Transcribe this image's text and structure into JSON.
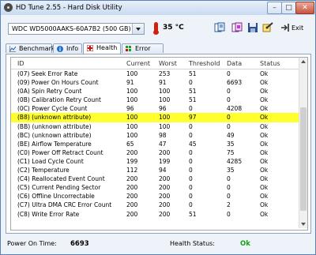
{
  "window": {
    "title": "HD Tune 2.55 - Hard Disk Utility",
    "min_label": "–",
    "max_label": "□",
    "close_label": "✕"
  },
  "toolbar": {
    "drive": "WDC WD5000AAKS-60A7B2 (500 GB)",
    "temperature": "35 °C",
    "exit_label": "Exit",
    "icons": [
      "copy-text-icon",
      "copy-image-icon",
      "save-icon",
      "options-icon",
      "exit-icon"
    ]
  },
  "tabs": [
    {
      "label": "Benchmark",
      "icon": "benchmark-icon"
    },
    {
      "label": "Info",
      "icon": "info-icon"
    },
    {
      "label": "Health",
      "icon": "health-cross-icon"
    },
    {
      "label": "Error Scan",
      "icon": "error-scan-icon"
    }
  ],
  "columns": [
    "ID",
    "Current",
    "Worst",
    "Threshold",
    "Data",
    "Status"
  ],
  "rows": [
    [
      "(07) Seek Error Rate",
      "100",
      "253",
      "51",
      "0",
      "Ok"
    ],
    [
      "(09) Power On Hours Count",
      "91",
      "91",
      "0",
      "6693",
      "Ok"
    ],
    [
      "(0A) Spin Retry Count",
      "100",
      "100",
      "51",
      "0",
      "Ok"
    ],
    [
      "(0B) Calibration Retry Count",
      "100",
      "100",
      "51",
      "0",
      "Ok"
    ],
    [
      "(0C) Power Cycle Count",
      "96",
      "96",
      "0",
      "4208",
      "Ok"
    ],
    [
      "(B8) (unknown attribute)",
      "100",
      "100",
      "97",
      "0",
      "Ok"
    ],
    [
      "(BB) (unknown attribute)",
      "100",
      "100",
      "0",
      "0",
      "Ok"
    ],
    [
      "(BC) (unknown attribute)",
      "100",
      "98",
      "0",
      "49",
      "Ok"
    ],
    [
      "(BE) Airflow Temperature",
      "65",
      "47",
      "45",
      "35",
      "Ok"
    ],
    [
      "(C0) Power Off Retract Count",
      "200",
      "200",
      "0",
      "75",
      "Ok"
    ],
    [
      "(C1) Load Cycle Count",
      "199",
      "199",
      "0",
      "4285",
      "Ok"
    ],
    [
      "(C2) Temperature",
      "112",
      "94",
      "0",
      "35",
      "Ok"
    ],
    [
      "(C4) Reallocated Event Count",
      "200",
      "200",
      "0",
      "0",
      "Ok"
    ],
    [
      "(C5) Current Pending Sector",
      "200",
      "200",
      "0",
      "0",
      "Ok"
    ],
    [
      "(C6) Offline Uncorrectable",
      "200",
      "200",
      "0",
      "0",
      "Ok"
    ],
    [
      "(C7) Ultra DMA CRC Error Count",
      "200",
      "200",
      "0",
      "2",
      "Ok"
    ],
    [
      "(C8) Write Error Rate",
      "200",
      "200",
      "51",
      "0",
      "Ok"
    ]
  ],
  "highlighted_row": 5,
  "status": {
    "power_on_label": "Power On Time:",
    "power_on_value": "6693",
    "health_label": "Health Status:",
    "health_value": "Ok"
  },
  "colors": {
    "highlight": "#ffff30",
    "health_ok": "#18a018",
    "temperature_icon": "#d02010"
  }
}
